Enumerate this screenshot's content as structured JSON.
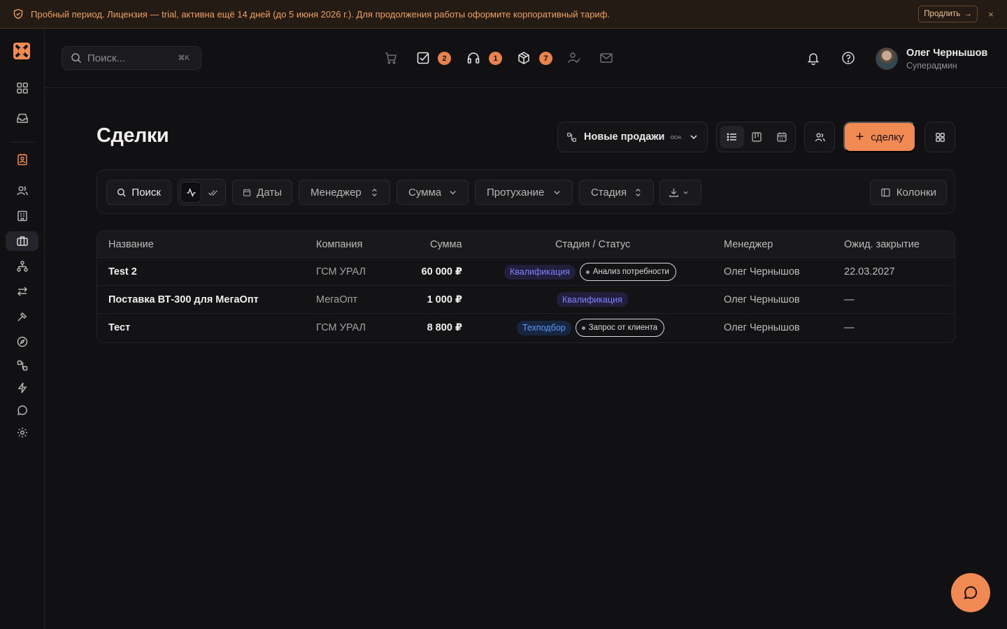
{
  "banner": {
    "text": "Пробный период. Лицензия — trial, активна ещё 14 дней (до 5 июня 2026 г.). Для продолжения работы оформите корпоративный тариф.",
    "extend_label": "Продлить",
    "close_label": "×"
  },
  "header": {
    "search_placeholder": "Поиск...",
    "search_shortcut": "⌘K",
    "badges": {
      "tasks": "2",
      "support": "1",
      "packages": "7"
    },
    "user": {
      "name": "Олег Чернышов",
      "role": "Суперадмин"
    }
  },
  "page": {
    "title": "Сделки",
    "pipeline_name": "Новые продажи",
    "pipeline_tag": "осн.",
    "add_label": "сделку"
  },
  "filters": {
    "search": "Поиск",
    "dates": "Даты",
    "manager": "Менеджер",
    "amount": "Сумма",
    "decay": "Протухание",
    "stage": "Стадия",
    "columns": "Колонки"
  },
  "table": {
    "headers": {
      "name": "Название",
      "company": "Компания",
      "amount": "Сумма",
      "stage": "Стадия / Статус",
      "manager": "Менеджер",
      "close": "Ожид. закрытие"
    },
    "rows": [
      {
        "name": "Test 2",
        "company": "ГСМ УРАЛ",
        "amount": "60 000 ₽",
        "stage": "Квалификация",
        "status": "Анализ потребности",
        "manager": "Олег Чернышов",
        "close": "22.03.2027"
      },
      {
        "name": "Поставка ВТ-300 для МегаОпт",
        "company": "МегаОпт",
        "amount": "1 000 ₽",
        "stage": "Квалификация",
        "status": "",
        "manager": "Олег Чернышов",
        "close": "—"
      },
      {
        "name": "Тест",
        "company": "ГСМ УРАЛ",
        "amount": "8 800 ₽",
        "stage": "Техподбор",
        "status": "Запрос от клиента",
        "manager": "Олег Чернышов",
        "close": "—"
      }
    ]
  },
  "colors": {
    "accent": "#f08a52",
    "background": "#111113",
    "stage_qualification": "#7f80ff",
    "stage_tech": "#5b9cf8",
    "banner_text": "#f0a060"
  }
}
